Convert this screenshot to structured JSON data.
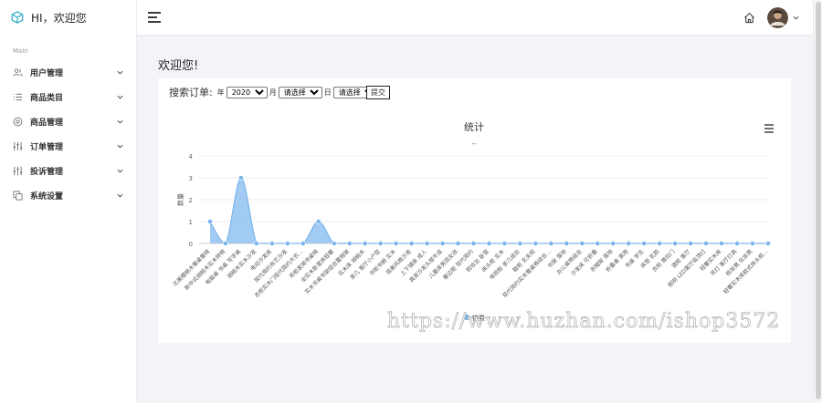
{
  "sidebar": {
    "brand_title": "HI，欢迎您",
    "section_label": "Main",
    "items": [
      {
        "label": "用户管理",
        "icon": "users-icon"
      },
      {
        "label": "商品类目",
        "icon": "list-icon"
      },
      {
        "label": "商品管理",
        "icon": "settings-icon"
      },
      {
        "label": "订单管理",
        "icon": "sliders-icon"
      },
      {
        "label": "投诉管理",
        "icon": "sliders-icon"
      },
      {
        "label": "系统设置",
        "icon": "copy-icon"
      }
    ]
  },
  "header": {
    "menu_icon": "hamburger-icon",
    "home_icon": "home-icon",
    "avatar_icon": "avatar"
  },
  "main": {
    "welcome": "欢迎您!",
    "search": {
      "label": "搜索订单:",
      "year_prefix": "年",
      "year_value": "2020",
      "month_suffix": "月",
      "month_value": "请选择",
      "day_suffix": "日",
      "day_value": "请选择",
      "submit_label": "提交"
    }
  },
  "chart_data": {
    "type": "area",
    "title": "统计",
    "subtitle": "--",
    "xlabel": "",
    "ylabel": "数量",
    "ylim": [
      0,
      4
    ],
    "yticks": [
      0,
      1,
      2,
      3,
      4
    ],
    "legend_position": "bottom",
    "categories": [
      "北美樱桃木餐桌餐椅",
      "新中式胡桃木实木转椅",
      "电脑桌 书桌 写字桌",
      "胡桃木实木沙发",
      "电动沙发床",
      "现代简约布艺沙发",
      "衣柜实木门现代简约大衣...",
      "吊柜家用书桌椅",
      "全实木卧室床轻奢",
      "实木书桌书架组合置物架",
      "实木床 胡桃木",
      "茶几 客厅小户型",
      "书柜书橱 实木",
      "简美风格沙发",
      "上下铺床 成人",
      "真皮沙发头层牛皮",
      "儿童床男孩女孩",
      "餐边柜 现代简约",
      "梳妆台 卧室",
      "床头柜 实木",
      "电视柜 茶几组合",
      "鞋柜 玄关柜",
      "现代简约实木餐桌椅组合...",
      "书架 落地",
      "办公桌椅组合",
      "沙发床 可折叠",
      "衣帽架 落地",
      "折叠桌 家用",
      "书桌 学生",
      "床垫 乳胶",
      "衣柜 推拉门",
      "酒柜 客厅",
      "照明 LED客厅吸顶灯",
      "轻奢实木床",
      "吊灯 客厅灯具",
      "梳妆凳 化妆凳",
      "轻奢实木床欧式床头柜..."
    ],
    "series": [
      {
        "name": "销量",
        "values": [
          1,
          0,
          3,
          0,
          0,
          0,
          0,
          1,
          0,
          0,
          0,
          0,
          0,
          0,
          0,
          0,
          0,
          0,
          0,
          0,
          0,
          0,
          0,
          0,
          0,
          0,
          0,
          0,
          0,
          0,
          0,
          0,
          0,
          0,
          0,
          0,
          0
        ],
        "color": "#90c2f0"
      }
    ],
    "menu_icon": "chart-menu-icon"
  },
  "watermark": "https://www.huzhan.com/ishop3572"
}
